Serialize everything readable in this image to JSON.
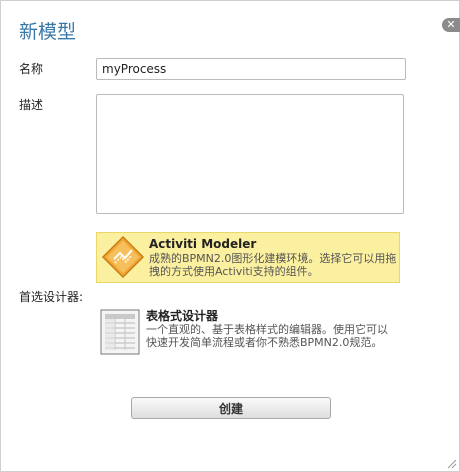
{
  "dialog": {
    "title": "新模型",
    "close_glyph": "✕"
  },
  "form": {
    "name_label": "名称",
    "name_value": "myProcess",
    "description_label": "描述",
    "description_value": "",
    "designer_label": "首选设计器:"
  },
  "designers": [
    {
      "title": "Activiti Modeler",
      "description": "成熟的BPMN2.0图形化建模环境。选择它可以用拖拽的方式使用Activiti支持的组件。",
      "icon": "activiti-modeler-icon",
      "selected": true
    },
    {
      "title": "表格式设计器",
      "description": "一个直观的、基于表格样式的编辑器。使用它可以快速开发简单流程或者你不熟悉BPMN2.0规范。",
      "icon": "table-editor-icon",
      "selected": false
    }
  ],
  "actions": {
    "create_label": "创建"
  },
  "colors": {
    "title": "#3a78a8",
    "selected_bg": "#fbefa0",
    "selected_border": "#e9d76a",
    "icon_orange": "#f0a030"
  }
}
